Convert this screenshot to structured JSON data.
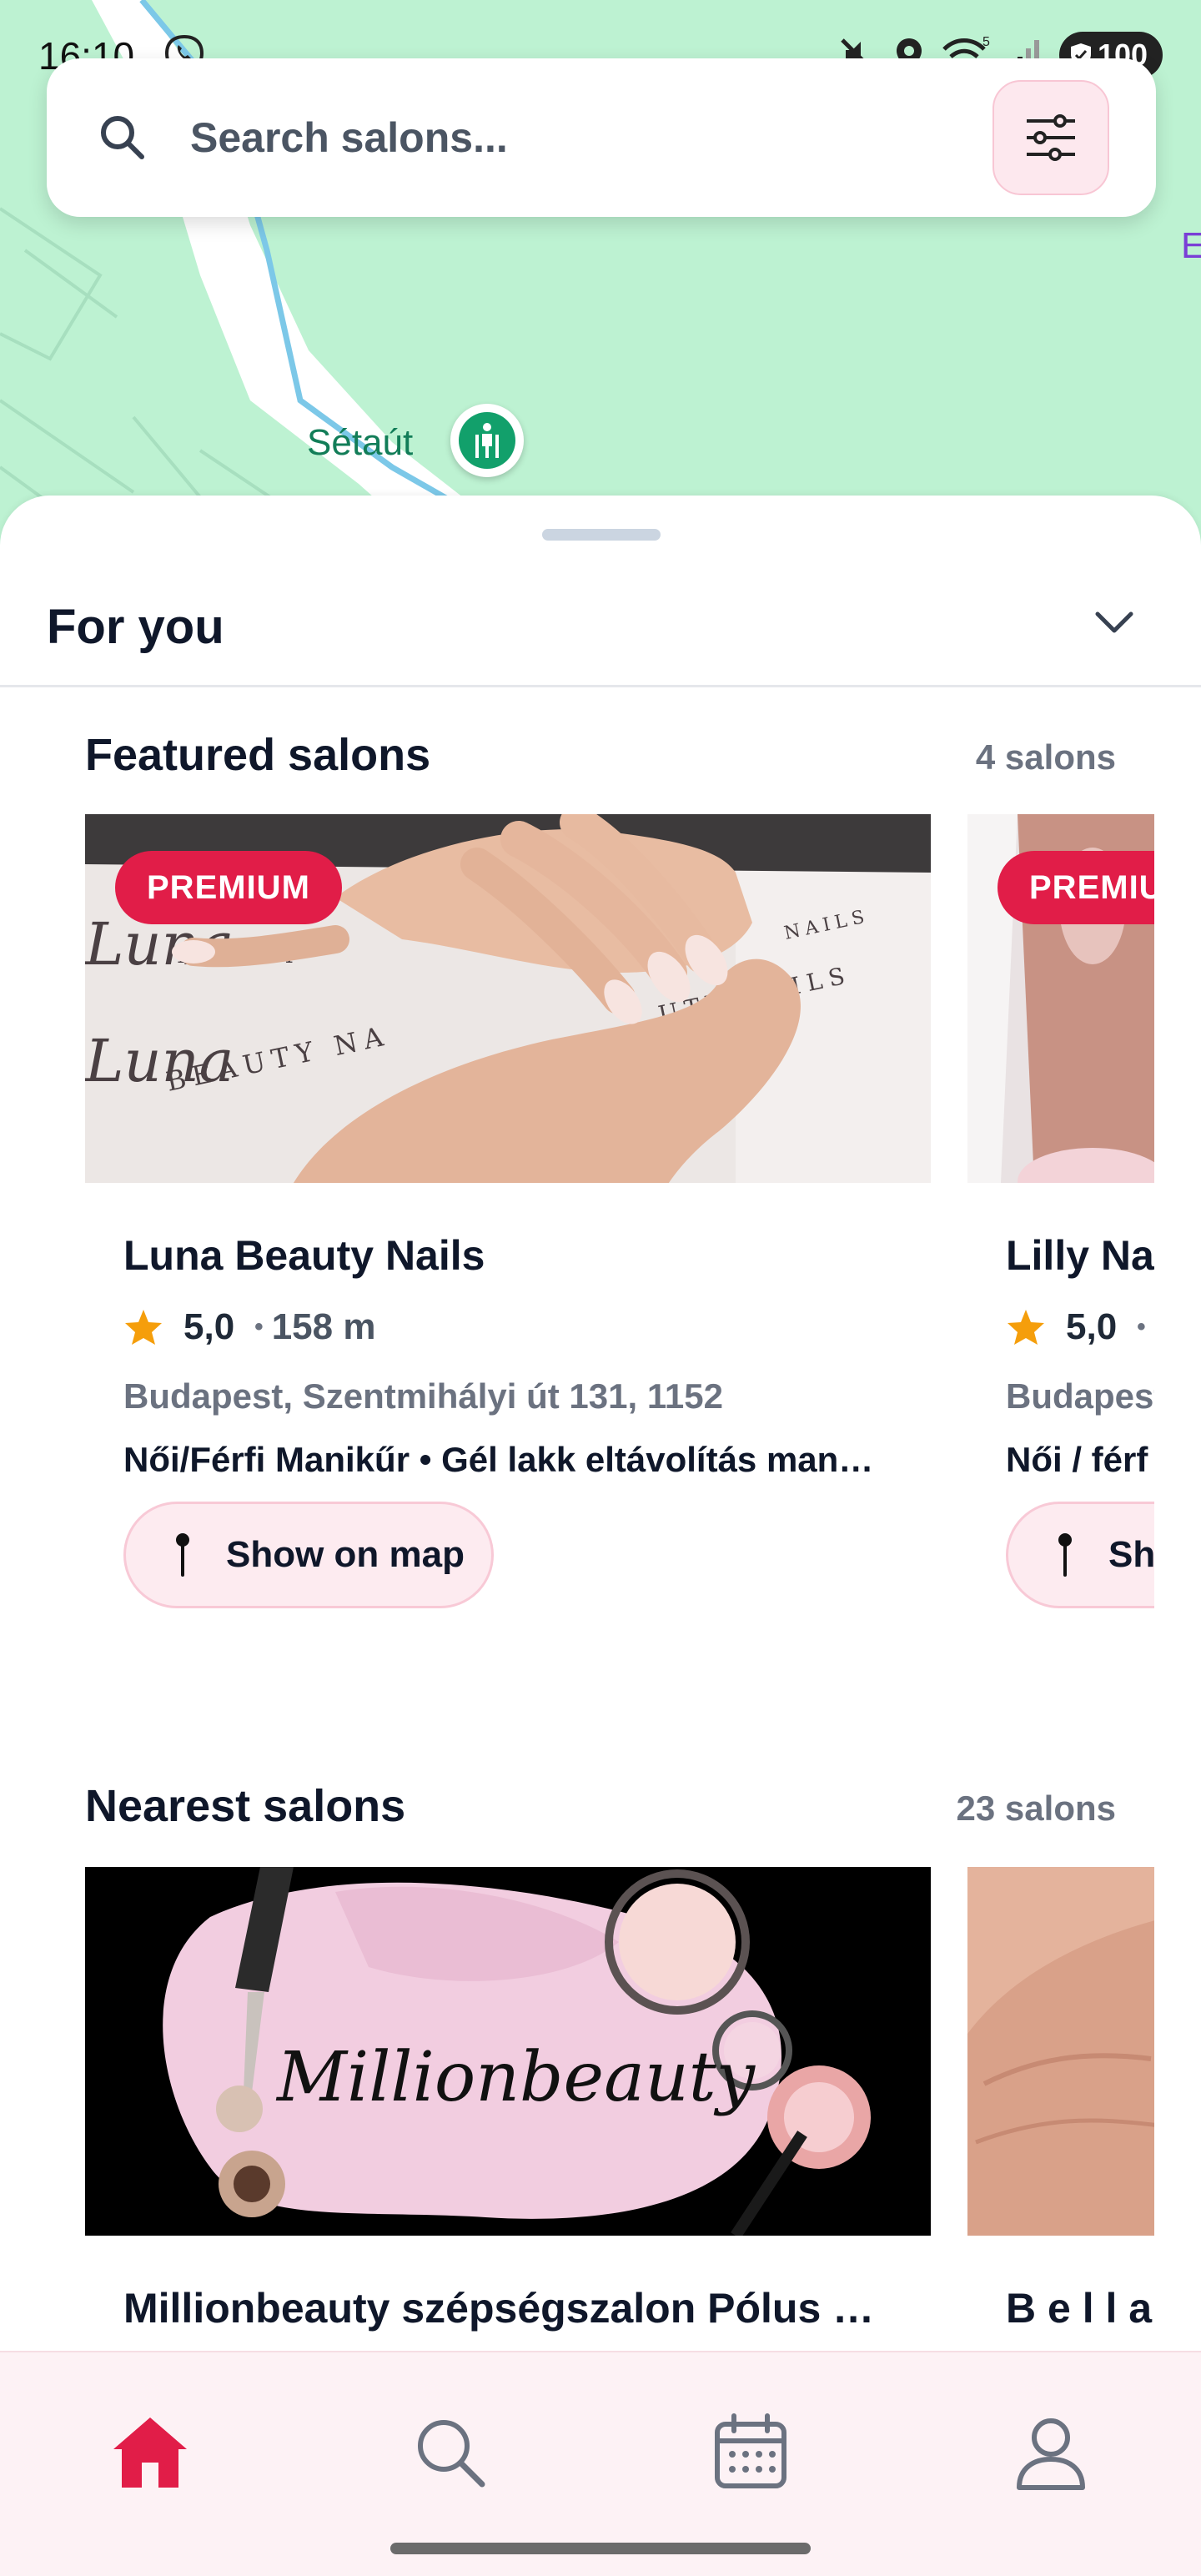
{
  "status_bar": {
    "time": "16:10",
    "battery": "100",
    "signal_superscript": "5"
  },
  "map": {
    "poi_label": "Sétaút",
    "edge_letter": "E"
  },
  "search": {
    "placeholder": "Search salons..."
  },
  "sheet": {
    "title": "For you"
  },
  "featured": {
    "title": "Featured salons",
    "count": "4 salons",
    "cards": [
      {
        "badge": "PREMIUM",
        "name": "Luna Beauty Nails",
        "rating": "5,0",
        "distance": "158 m",
        "address": "Budapest, Szentmihályi út 131, 1152",
        "services": "Női/Férfi Manikűr • Gél lakk eltávolítás man…",
        "button": "Show on map"
      },
      {
        "badge": "PREMIU",
        "name": "Lilly Na",
        "rating": "5,0",
        "distance": "",
        "address": "Budapest",
        "services": "Női / férf",
        "button": "Sh"
      }
    ]
  },
  "nearest": {
    "title": "Nearest salons",
    "count": "23 salons",
    "cards": [
      {
        "image_text": "Millionbeauty",
        "name": "Millionbeauty szépségszalon Pólus …"
      },
      {
        "name": "B e l l a"
      }
    ]
  },
  "nav": {
    "items": [
      "home-icon",
      "search-icon",
      "calendar-icon",
      "profile-icon"
    ],
    "active": "home-icon"
  },
  "colors": {
    "accent": "#e11d48",
    "map_green": "#bdf2d2",
    "star": "#f59e0b"
  }
}
